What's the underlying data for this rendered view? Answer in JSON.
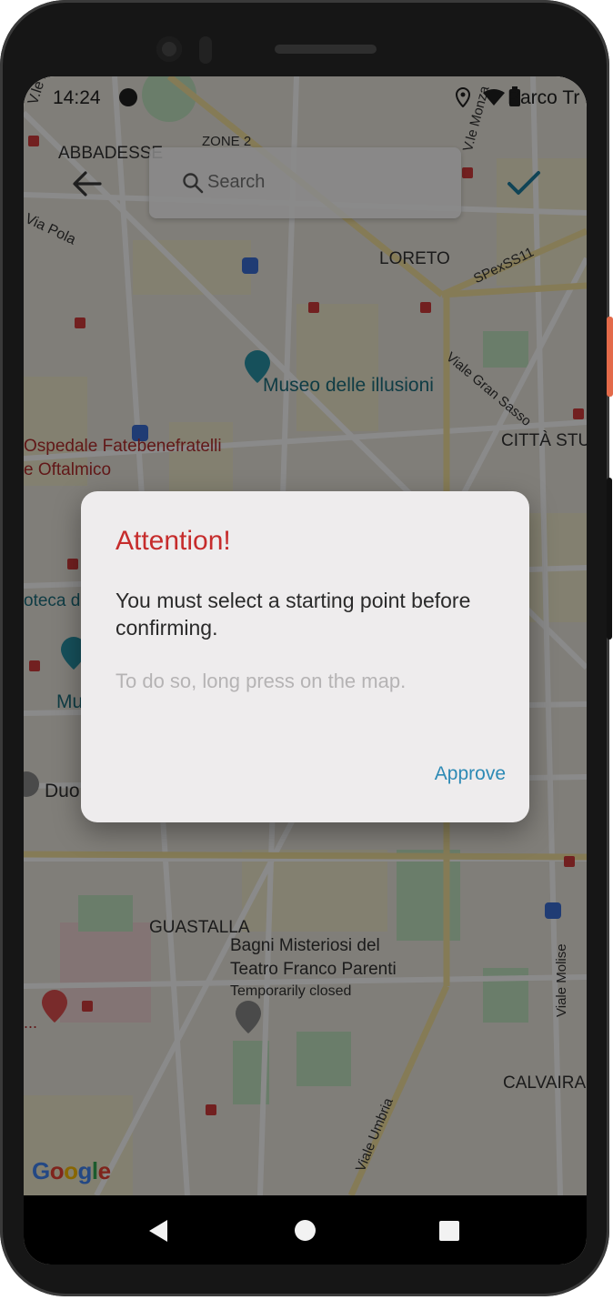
{
  "status_bar": {
    "time": "14:24",
    "carrier": "Parco Tr"
  },
  "map": {
    "labels": {
      "viale_zara": "V.le Zara",
      "abbadesse": "ABBADESSE",
      "zone2": "ZONE 2",
      "viale_monza": "V.le Monza",
      "via_pola": "Via Pola",
      "loreto": "LORETO",
      "spexss11": "SPexSS11",
      "museo": "Museo delle illusioni",
      "viale_gran_sasso": "Viale Gran Sasso",
      "citta_studi": "CITTÀ STU",
      "ospedale_line1": "Ospedale Fatebenefratelli",
      "ospedale_line2": "e Oftalmico",
      "pinacoteca": "oteca d",
      "mu": "Mu",
      "duomo": "Duo",
      "guastalla": "GUASTALLA",
      "bagni_line1": "Bagni Misteriosi del",
      "bagni_line2": "Teatro Franco Parenti",
      "temporarily_closed": "Temporarily closed",
      "viale_molise": "Viale Molise",
      "calvairate": "CALVAIRA",
      "viale_umbria": "Viale Umbria",
      "hospital_dots": "..."
    },
    "google_logo": [
      "G",
      "o",
      "o",
      "g",
      "l",
      "e"
    ],
    "colors": {
      "water": "#aadaff",
      "park": "#c5e8c5",
      "road": "#ffffff",
      "highway": "#f6e3a0",
      "block": "#f3ecd0"
    }
  },
  "search": {
    "placeholder": "Search"
  },
  "dialog": {
    "title": "Attention!",
    "message": "You must select a starting point before confirming.",
    "hint": "To do so, long press on the map.",
    "approve_label": "Approve"
  },
  "icons": {
    "back": "arrow-left-icon",
    "search": "search-icon",
    "confirm": "checkmark-icon",
    "location": "location-pin-icon",
    "wifi": "wifi-icon",
    "battery": "battery-icon",
    "nav_back": "triangle-back-icon",
    "nav_home": "circle-home-icon",
    "nav_recents": "square-recents-icon"
  },
  "accent_colors": {
    "title_red": "#c62c2c",
    "approve_blue": "#2d8ab5",
    "check_teal": "#1f7fa0"
  }
}
